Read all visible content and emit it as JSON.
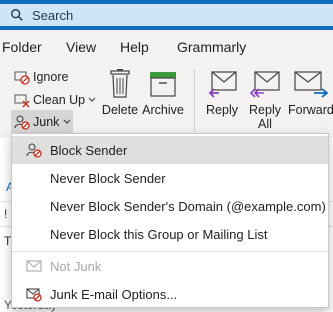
{
  "search": {
    "placeholder": "Search"
  },
  "menubar": {
    "items": [
      "Folder",
      "View",
      "Help",
      "Grammarly"
    ]
  },
  "ribbon": {
    "ignore": "Ignore",
    "cleanup": "Clean Up",
    "junk": "Junk",
    "delete": "Delete",
    "archive": "Archive",
    "reply": "Reply",
    "reply_all_line1": "Reply",
    "reply_all_line2": "All",
    "forward": "Forward",
    "peek_letter": "d"
  },
  "background": {
    "tab_letter": "A",
    "row_marker": "!",
    "row_t": "T",
    "right_glyph": "i",
    "yesterday": "Yesterday"
  },
  "junk_menu": {
    "items": [
      {
        "label": "Block Sender",
        "icon": "block-sender-icon",
        "highlighted": true,
        "enabled": true
      },
      {
        "label": "Never Block Sender",
        "enabled": true
      },
      {
        "label": "Never Block Sender's Domain (@example.com)",
        "enabled": true
      },
      {
        "label": "Never Block this Group or Mailing List",
        "enabled": true
      },
      {
        "label": "Not Junk",
        "icon": "not-junk-envelope-icon",
        "enabled": false
      },
      {
        "label": "Junk E-mail Options...",
        "icon": "junk-options-icon",
        "enabled": true
      }
    ]
  },
  "colors": {
    "titlebar": "#0f6cbd",
    "search_bg": "#cfe4f5",
    "highlight": "#e1dfdd",
    "red": "#c42b1c",
    "purple": "#8a3fbf",
    "green": "#3a9a3a"
  }
}
